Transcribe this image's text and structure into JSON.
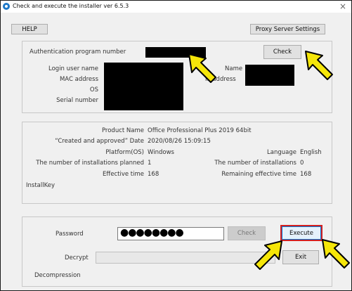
{
  "window": {
    "title": "Check and execute the installer ver 6.5.3",
    "close_glyph": "×"
  },
  "toolbar": {
    "help_label": "HELP",
    "proxy_label": "Proxy Server Settings"
  },
  "auth": {
    "program_number_label": "Authentication program number",
    "check_label": "Check",
    "login_user_label": "Login user name",
    "mac_label": "MAC address",
    "os_label": "OS",
    "serial_label": "Serial number",
    "name_label": "Name",
    "ip_label": "IP address"
  },
  "product": {
    "product_name_label": "Product Name",
    "product_name_value": "Office Professional Plus 2019 64bit",
    "created_label": "“Created and approved” Date",
    "created_value": "2020/08/26 15:09:15",
    "platform_label": "Platform(OS)",
    "platform_value": "Windows",
    "language_label": "Language",
    "language_value": "English",
    "planned_label": "The number of installations planned",
    "planned_value": "1",
    "installs_label": "The number of installations",
    "installs_value": "0",
    "eff_time_label": "Effective time",
    "eff_time_value": "168",
    "remaining_label": "Remaining effective time",
    "remaining_value": "168",
    "installkey_label": "InstallKey"
  },
  "execute": {
    "password_label": "Password",
    "password_value": "●●●●●●●●",
    "check_label": "Check",
    "execute_label": "Execute",
    "decrypt_label": "Decrypt",
    "exit_label": "Exit",
    "decompression_label": "Decompression"
  },
  "annotations": {
    "arrow_color": "#f5e609",
    "arrow_outline": "#000000",
    "highlight_color": "#d42020"
  }
}
